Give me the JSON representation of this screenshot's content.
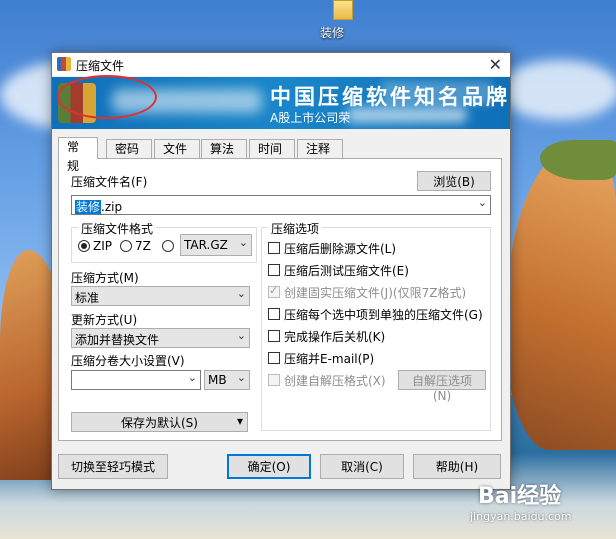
{
  "desktop": {
    "icon_label": "装修"
  },
  "window": {
    "title": "压缩文件",
    "close_glyph": "✕"
  },
  "banner": {
    "title": "中国压缩软件知名品牌",
    "subtitle": "A股上市公司荣"
  },
  "tabs": [
    {
      "label": "常规",
      "active": true
    },
    {
      "label": "密码",
      "active": false
    },
    {
      "label": "文件",
      "active": false
    },
    {
      "label": "算法",
      "active": false
    },
    {
      "label": "时间",
      "active": false
    },
    {
      "label": "注释",
      "active": false
    }
  ],
  "general": {
    "archive_name_label": "压缩文件名(F)",
    "browse_button": "浏览(B)",
    "archive_name_selected": "装修",
    "archive_name_ext": ".zip",
    "format_group_title": "压缩文件格式",
    "formats": [
      {
        "label": "ZIP",
        "selected": true
      },
      {
        "label": "7Z",
        "selected": false
      },
      {
        "label": "",
        "selected": false
      }
    ],
    "format_other_value": "TAR.GZ",
    "method_label": "压缩方式(M)",
    "method_value": "标准",
    "update_label": "更新方式(U)",
    "update_value": "添加并替换文件",
    "split_label": "压缩分卷大小设置(V)",
    "split_value": "",
    "split_unit": "MB",
    "save_default_button": "保存为默认(S)",
    "options_group_title": "压缩选项",
    "options": [
      {
        "label": "压缩后删除源文件(L)",
        "checked": false,
        "disabled": false
      },
      {
        "label": "压缩后测试压缩文件(E)",
        "checked": false,
        "disabled": false
      },
      {
        "label": "创建固实压缩文件(J)(仅限7Z格式)",
        "checked": true,
        "disabled": true
      },
      {
        "label": "压缩每个选中项到单独的压缩文件(G)",
        "checked": false,
        "disabled": false
      },
      {
        "label": "完成操作后关机(K)",
        "checked": false,
        "disabled": false
      },
      {
        "label": "压缩并E-mail(P)",
        "checked": false,
        "disabled": false
      },
      {
        "label": "创建自解压格式(X)",
        "checked": false,
        "disabled": true
      }
    ],
    "sfx_options_button": "自解压选项(N)"
  },
  "footer": {
    "simple_mode_button": "切换至轻巧模式",
    "ok_button": "确定(O)",
    "cancel_button": "取消(C)",
    "help_button": "帮助(H)"
  },
  "watermark": {
    "brand": "Bai经验",
    "url": "jingyan.baidu.com"
  },
  "colors": {
    "accent": "#0078d7",
    "banner": "#1a86c9",
    "annotation_circle": "#e03030"
  }
}
